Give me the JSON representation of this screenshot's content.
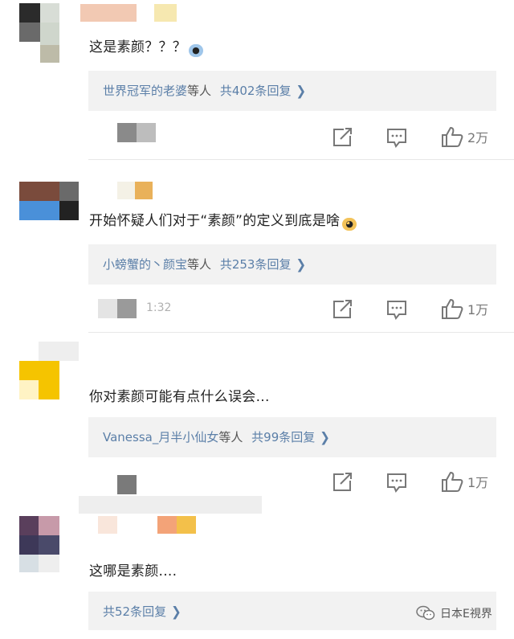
{
  "comments": [
    {
      "text": "这是素颜？？？",
      "reply": {
        "users": "世界冠军的老婆",
        "suffix": "等人",
        "count": "共402条回复"
      },
      "likes": "2万"
    },
    {
      "text": "开始怀疑人们对于“素颜”的定义到底是啥",
      "reply": {
        "users": "小螃蟹的丶颜宝",
        "suffix": "等人",
        "count": "共253条回复"
      },
      "time": "1:32",
      "likes": "1万"
    },
    {
      "text": "你对素颜可能有点什么误会...",
      "reply": {
        "users": "Vanessa_月半小仙女",
        "suffix": "等人",
        "count": "共99条回复"
      },
      "likes": "1万"
    },
    {
      "text": "这哪是素颜....",
      "reply": {
        "users": "",
        "suffix": "",
        "count": "共52条回复"
      }
    }
  ],
  "icons": {
    "share": "share-icon",
    "comment": "comment-icon",
    "like": "thumbs-up-icon",
    "chevron": "chevron-right-icon",
    "watermark": "wechat-logo-icon"
  },
  "watermark": "日本E視界",
  "colors": {
    "link": "#5b7fa8",
    "reply_bg": "#f2f2f2",
    "icon": "#777777",
    "divider": "#e8e8e8"
  }
}
